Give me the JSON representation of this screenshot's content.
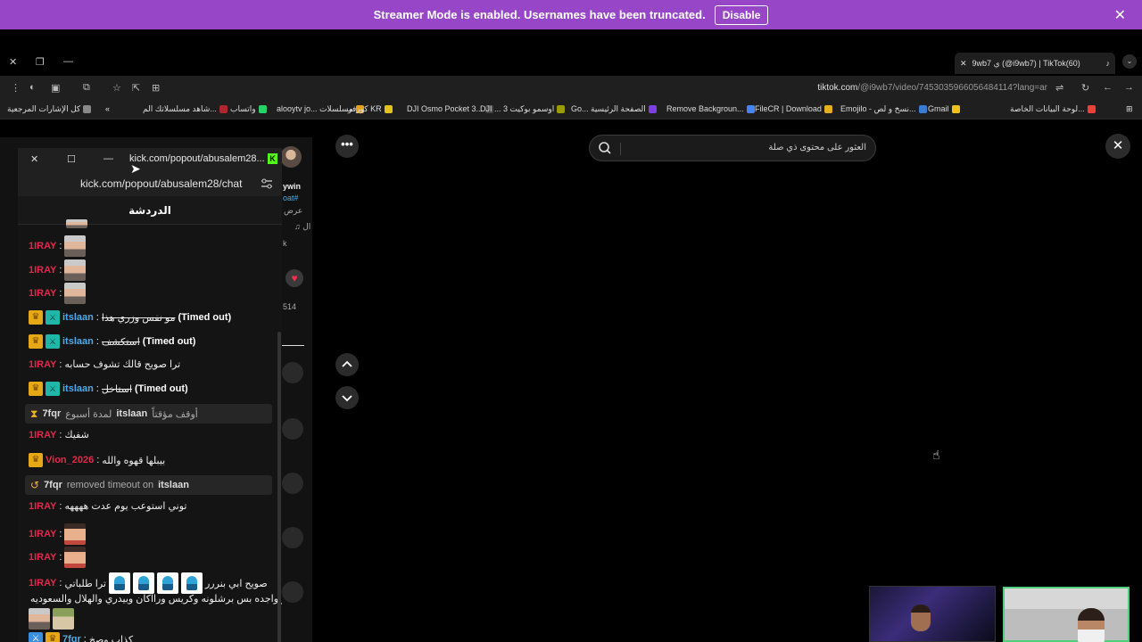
{
  "banner": {
    "text": "Streamer Mode is enabled. Usernames have been truncated.",
    "button": "Disable",
    "close": "✕"
  },
  "browser": {
    "tab_title": "9wb7 ي (@i9wb7) | TikTok(60)",
    "tab_close": "✕",
    "tab_plus": "+",
    "url_host": "tiktok.com",
    "url_path": "/@i9wb7/video/7453035966056484114?lang=ar",
    "bookmarks": [
      {
        "label": "كل الإشارات المرجعية",
        "color": "#888888"
      },
      {
        "label": "شاهد مسلسلاتك الم...",
        "color": "#b0262c"
      },
      {
        "label": "واتساب",
        "color": "#25d366"
      },
      {
        "label": "alooytv jo... مسلسلات",
        "color": "#e1a21b"
      },
      {
        "label": "كورفر KR",
        "color": "#e3c21b"
      },
      {
        "label": "DJI Osmo Pocket 3...",
        "color": "#444444"
      },
      {
        "label": "DJI ... اوسمو بوكيت 3",
        "color": "#9c9c00"
      },
      {
        "label": "Go... الصفحة الرئيسية",
        "color": "#7b3fe4"
      },
      {
        "label": "Remove Backgroun...",
        "color": "#4285f4"
      },
      {
        "label": "FileCR | Download",
        "color": "#e1b21b"
      },
      {
        "label": "Emojilo - نسخ و لص...",
        "color": "#3a7bd5"
      },
      {
        "label": "Gmail",
        "color": "#f2c21b"
      },
      {
        "label": "لوحة البيانات الخاصة...",
        "color": "#ea4335"
      }
    ]
  },
  "tiktok": {
    "search_placeholder": "العثور على محتوى ذي صلة",
    "dots": "•••",
    "close": "✕",
    "profile_name": "ywin",
    "profile_tag": "oat#",
    "profile_line1": "عرض",
    "profile_line2": "♫ ال",
    "profile_line3": "k",
    "count": "514",
    "heart": "♥"
  },
  "popout": {
    "title": "kick.com/popout/abusalem28...",
    "url": "kick.com/popout/abusalem28/chat",
    "chat_header": "الدردشة",
    "messages": [
      {
        "user": "1IRAY",
        "text": ""
      },
      {
        "user": "1IRAY",
        "text": ""
      },
      {
        "user": "1IRAY",
        "text": ""
      },
      {
        "user": "itslaan",
        "text": "مو نفس وزري هذا",
        "suffix": "(Timed out)"
      },
      {
        "user": "itslaan",
        "text": "استكشف",
        "suffix": "(Timed out)"
      },
      {
        "user": "1IRAY",
        "text": "ترا صويح قالك تشوف حسابه"
      },
      {
        "user": "itslaan",
        "text": "استاخل",
        "suffix": "(Timed out)"
      },
      {
        "user": "1IRAY",
        "text": "شفيك"
      },
      {
        "user": "Vion_2026",
        "text": "بيبلها قهوه والله"
      },
      {
        "user": "1IRAY",
        "text": "توني استوعب يوم عدت ههههه"
      },
      {
        "user": "1IRAY",
        "text": ""
      },
      {
        "user": "1IRAY",
        "text": ""
      },
      {
        "user": "1IRAY",
        "text": "ترا طلباتي",
        "text2": "صويح ابي بنررر",
        "line2": "مو واجده بس برشلونه وكريس ورااكان وبيدري والهلال والسعوديه"
      },
      {
        "user": "7fqr",
        "text": "كذاب وصخ"
      }
    ],
    "sys1": {
      "mod": "7fqr",
      "target": "itslaan",
      "prefix": "لمدة أسبوع",
      "action": "أوقف مؤقتاً"
    },
    "sys2": {
      "mod": "7fqr",
      "text": "removed timeout on",
      "target": "itslaan"
    }
  }
}
